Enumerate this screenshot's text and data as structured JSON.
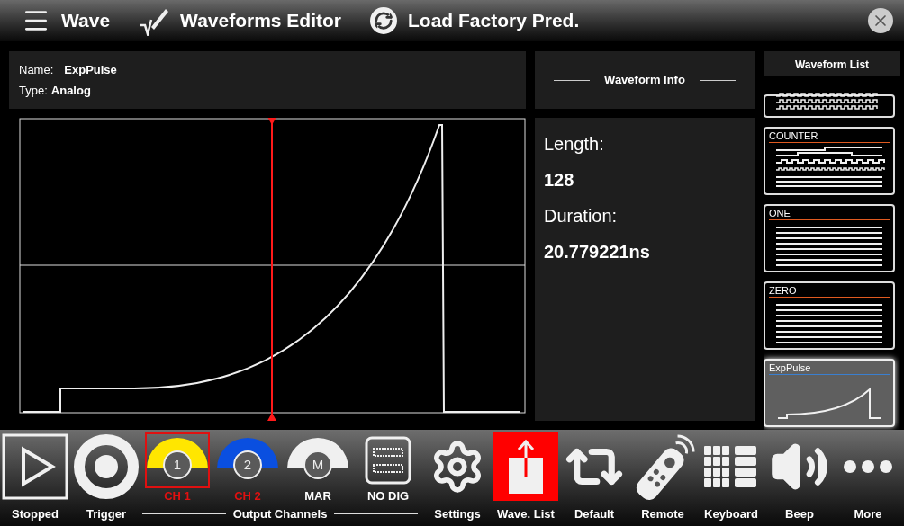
{
  "header": {
    "menu_label": "Wave",
    "editor_label": "Waveforms Editor",
    "load_label": "Load Factory Pred."
  },
  "waveform": {
    "name_label": "Name:",
    "name": "ExpPulse",
    "type_label": "Type:",
    "type": "Analog"
  },
  "info": {
    "title": "Waveform Info",
    "length_label": "Length:",
    "length": "128",
    "duration_label": "Duration:",
    "duration": "20.779221ns"
  },
  "waveform_list": {
    "title": "Waveform List",
    "items": [
      {
        "kind": "clock",
        "selected": false
      },
      {
        "name": "COUNTER",
        "kind": "counter",
        "selected": false
      },
      {
        "name": "ONE",
        "kind": "lines",
        "selected": false
      },
      {
        "name": "ZERO",
        "kind": "lines",
        "selected": false
      },
      {
        "name": "ExpPulse",
        "kind": "exp",
        "selected": true
      }
    ]
  },
  "toolbar": {
    "left": [
      {
        "kind": "play",
        "label": "Stopped"
      },
      {
        "kind": "trigger",
        "label": "Trigger"
      }
    ],
    "channels_label": "Output Channels",
    "channels": [
      {
        "kind": "channel",
        "badge": "1",
        "label": "CH 1",
        "color": "#ffe600",
        "on": false,
        "selected": true
      },
      {
        "kind": "channel",
        "badge": "2",
        "label": "CH 2",
        "color": "#0a4fe0",
        "on": false,
        "selected": false
      },
      {
        "kind": "channel",
        "badge": "M",
        "label": "MAR",
        "color": "#f0f0f0",
        "on": true,
        "selected": false
      },
      {
        "kind": "digital",
        "label": "NO DIG",
        "on": true,
        "selected": false
      }
    ],
    "right": [
      {
        "kind": "settings",
        "label": "Settings",
        "active": false
      },
      {
        "kind": "upload",
        "label": "Wave. List",
        "active": true
      },
      {
        "kind": "repeat",
        "label": "Default",
        "active": false
      },
      {
        "kind": "remote",
        "label": "Remote",
        "active": false
      },
      {
        "kind": "keyboard",
        "label": "Keyboard",
        "active": false
      },
      {
        "kind": "sound",
        "label": "Beep",
        "active": false
      },
      {
        "kind": "more",
        "label": "More",
        "active": false
      }
    ]
  }
}
